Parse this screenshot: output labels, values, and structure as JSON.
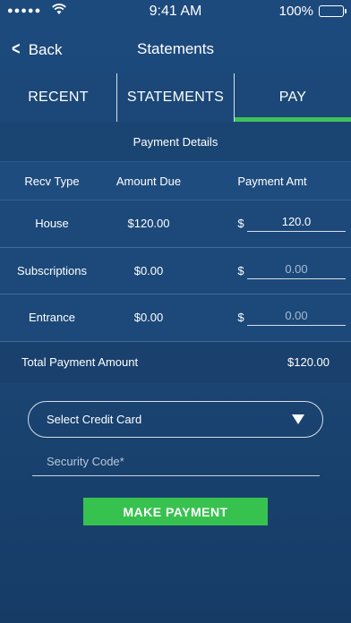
{
  "status_bar": {
    "signal": "●●●●●",
    "wifi_icon": "wifi-icon",
    "time": "9:41 AM",
    "battery": "100%"
  },
  "nav": {
    "back_label": "Back",
    "title": "Statements"
  },
  "tabs": [
    {
      "label": "RECENT",
      "active": false
    },
    {
      "label": "STATEMENTS",
      "active": false
    },
    {
      "label": "PAY",
      "active": true
    }
  ],
  "payment": {
    "section_title": "Payment Details",
    "headers": [
      "Recv Type",
      "Amount Due",
      "Payment Amt"
    ],
    "currency": "$",
    "rows": [
      {
        "type": "House",
        "amount_due": "$120.00",
        "payment_amt": "120.0"
      },
      {
        "type": "Subscriptions",
        "amount_due": "$0.00",
        "payment_amt": "0.00"
      },
      {
        "type": "Entrance",
        "amount_due": "$0.00",
        "payment_amt": "0.00"
      }
    ],
    "total_label": "Total Payment Amount",
    "total_value": "$120.00"
  },
  "form": {
    "select_card_label": "Select Credit Card",
    "security_placeholder": "Security Code*",
    "submit_label": "MAKE PAYMENT"
  },
  "colors": {
    "background": "#1d4a7d",
    "accent_green": "#37c24f",
    "tab_indicator": "#3ec35a"
  }
}
